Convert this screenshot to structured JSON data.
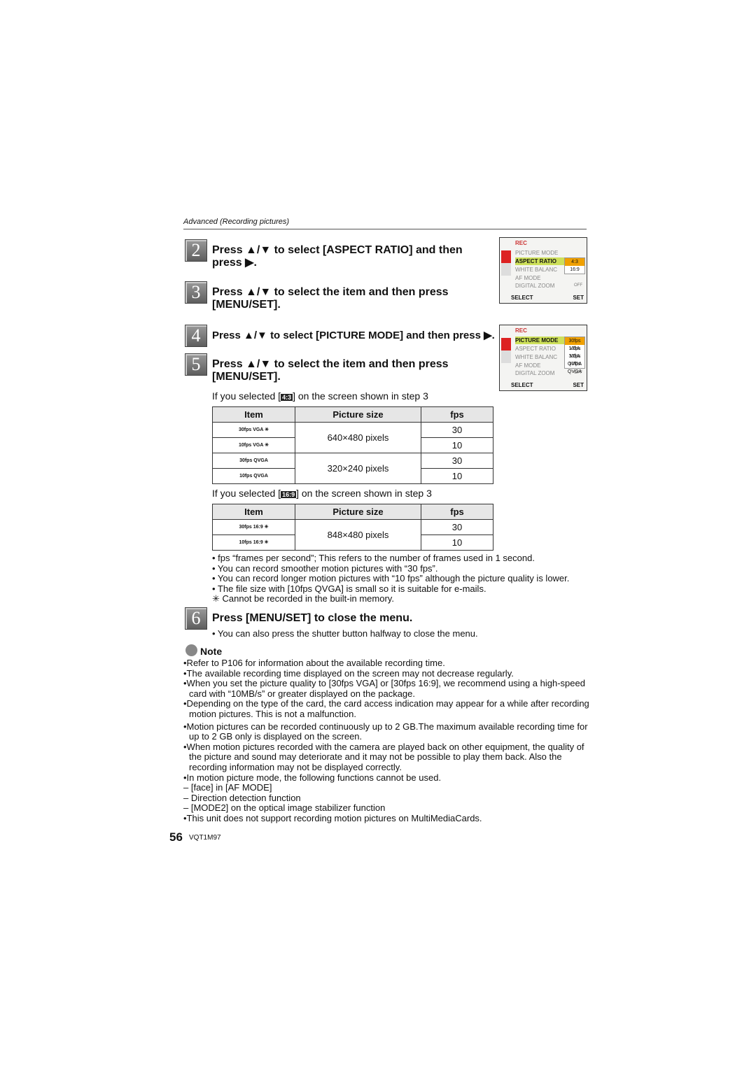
{
  "header": "Advanced (Recording pictures)",
  "steps": [
    {
      "num": "2",
      "text": "Press ▲/▼ to select [ASPECT RATIO] and then press ▶."
    },
    {
      "num": "3",
      "text": "Press ▲/▼ to select the item and then press [MENU/SET]."
    },
    {
      "num": "4",
      "text": "Press ▲/▼ to select [PICTURE MODE] and then press ▶."
    },
    {
      "num": "5",
      "text": "Press ▲/▼ to select the item and then press [MENU/SET]."
    },
    {
      "num": "6",
      "text": "Press [MENU/SET] to close the menu."
    }
  ],
  "camera": {
    "rec": "REC",
    "items": [
      "PICTURE MODE",
      "ASPECT RATIO",
      "WHITE BALANC",
      "AF MODE",
      "DIGITAL ZOOM"
    ],
    "select": "SELECT",
    "set": "SET",
    "aspect_options": [
      "4:3",
      "16:9"
    ],
    "mode_options": [
      "30fps VGA",
      "10fps VGA",
      "30fps QVGA",
      "10fps QVGA"
    ],
    "off": "OFF"
  },
  "table1": {
    "caption_pre": "If you selected [",
    "icon": "4:3",
    "caption_post": "] on the screen shown in step 3",
    "headers": [
      "Item",
      "Picture size",
      "fps"
    ],
    "rows": [
      {
        "item": "30fps VGA ✳",
        "fps": "30"
      },
      {
        "item": "10fps VGA ✳",
        "fps": "10"
      },
      {
        "item": "30fps QVGA",
        "fps": "30"
      },
      {
        "item": "10fps QVGA",
        "fps": "10"
      }
    ],
    "sizes": [
      "640×480 pixels",
      "320×240 pixels"
    ]
  },
  "table2": {
    "caption_pre": "If you selected [",
    "icon": "16:9",
    "caption_post": "] on the screen shown in step 3",
    "headers": [
      "Item",
      "Picture size",
      "fps"
    ],
    "rows": [
      {
        "item": "30fps 16:9 ✳",
        "fps": "30"
      },
      {
        "item": "10fps 16:9 ✳",
        "fps": "10"
      }
    ],
    "sizes": [
      "848×480 pixels"
    ]
  },
  "bullets": [
    "• fps “frames per second”; This refers to the number of frames used in 1 second.",
    "• You can record smoother motion pictures with “30 fps”.",
    "• You can record longer motion pictures with “10 fps” although the picture quality is lower.",
    "• The file size with [10fps QVGA] is small so it is suitable for e-mails.",
    "✳   Cannot be recorded in the built-in memory."
  ],
  "step6_bullet": "• You can also press the shutter button halfway to close the menu.",
  "note_title": "Note",
  "notes": [
    "•Refer to P106 for information about the available recording time.",
    "•The available recording time displayed on the screen may not decrease regularly.",
    "•When you set the picture quality to [30fps VGA] or [30fps 16:9], we recommend using a high-speed card with “10MB/s” or greater displayed on the package.",
    "•Depending on the type of the card, the card access indication may appear for a while after recording motion pictures. This is not a malfunction.",
    "•Motion pictures can be recorded continuously up to 2 GB.The maximum available recording time for up to 2 GB only is displayed on the screen.",
    "•When motion pictures recorded with the camera are played back on other equipment, the quality of the picture and sound may deteriorate and it may not be possible to play them back. Also the recording information may not be displayed correctly.",
    "•In motion picture mode, the following functions cannot be used.",
    "– [face] in [AF MODE]",
    "– Direction detection function",
    "– [MODE2] on the optical image stabilizer function",
    "•This unit does not support recording motion pictures on MultiMediaCards."
  ],
  "footer": {
    "page": "56",
    "code": "VQT1M97"
  }
}
